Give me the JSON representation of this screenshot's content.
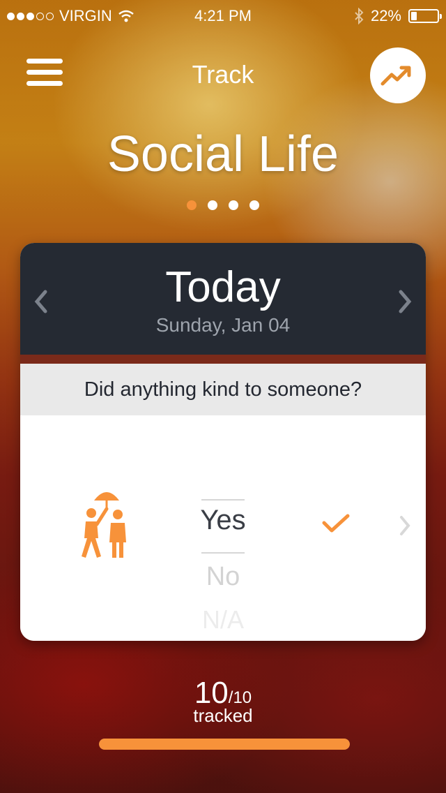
{
  "status_bar": {
    "carrier": "VIRGIN",
    "time": "4:21 PM",
    "battery": "22%",
    "battery_level": 0.22,
    "signal_bars_filled": 3,
    "signal_bars_total": 5
  },
  "header": {
    "title": "Track",
    "menu_icon": "hamburger-icon",
    "trend_icon": "trending-up-icon"
  },
  "category": {
    "title": "Social Life",
    "pages_total": 4,
    "active_page": 1
  },
  "card": {
    "day_title": "Today",
    "date": "Sunday, Jan 04",
    "question": "Did anything kind to someone?",
    "activity_icon": "umbrella-people-icon",
    "options": [
      "Yes",
      "No",
      "N/A"
    ],
    "selected": "Yes"
  },
  "progress": {
    "count": "10",
    "total": "/10",
    "label": "tracked",
    "fraction": 1.0
  },
  "colors": {
    "accent": "#f7923a",
    "dark_header": "#252a33",
    "question_bg": "#e9e9e9"
  }
}
